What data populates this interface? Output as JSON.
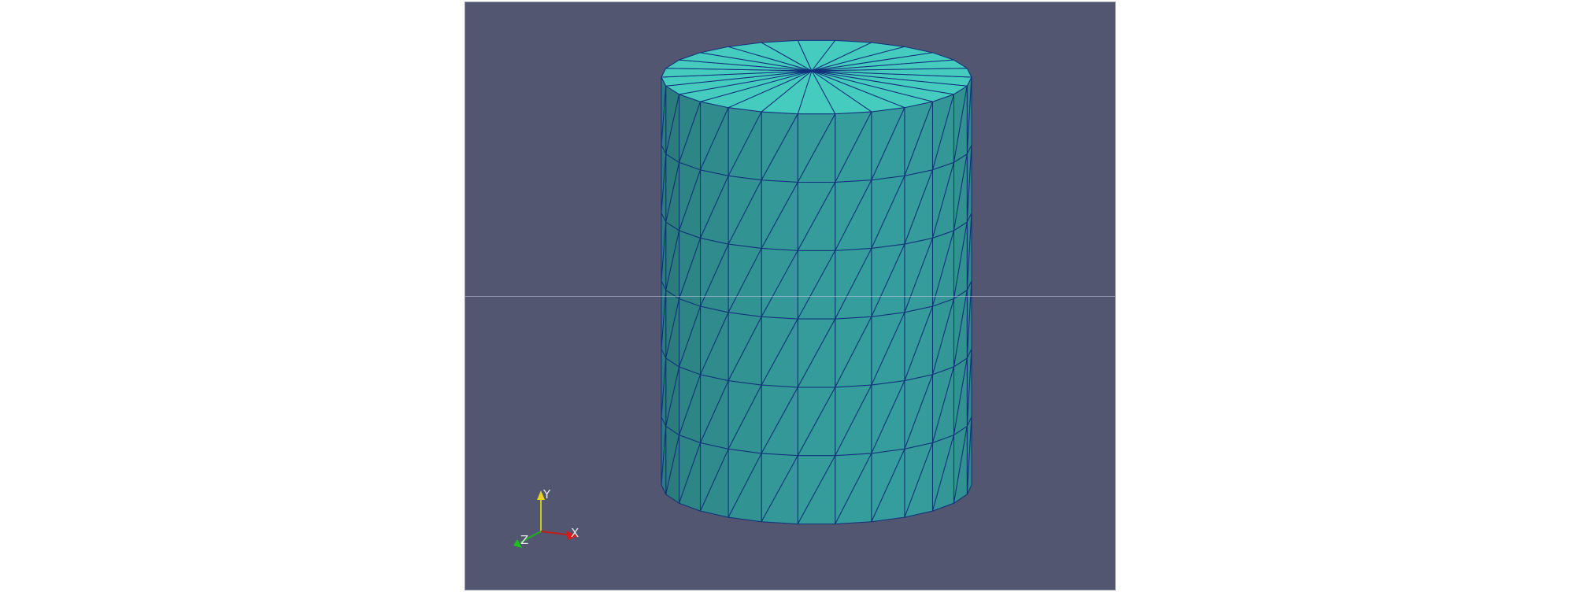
{
  "viewport": {
    "background": "#525671",
    "mesh": {
      "shape": "cylinder",
      "representation": "surface-with-edges",
      "top_color": "#46ccbf",
      "side_color": "#2f8a8a",
      "edge_color": "#10307a"
    }
  },
  "orientation_axes": {
    "y_label": "Y",
    "x_label": "X",
    "z_label": "Z",
    "y_color": "#e8d21c",
    "x_color": "#d21c1c",
    "z_color": "#1cc21c"
  }
}
